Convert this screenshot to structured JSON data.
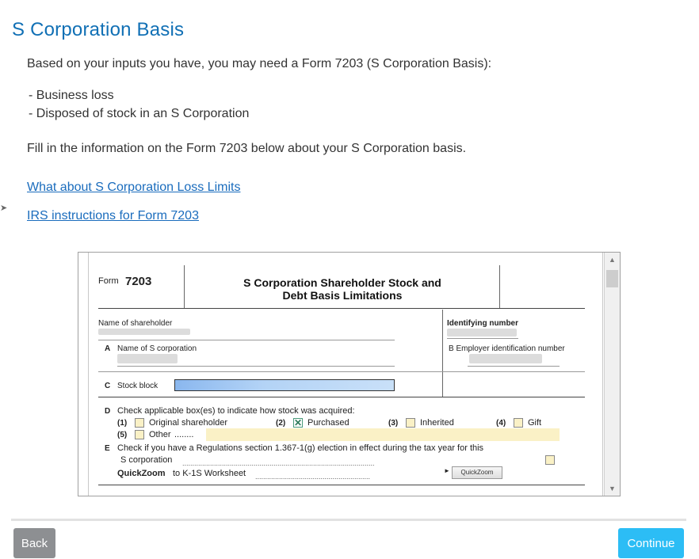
{
  "page": {
    "title": "S Corporation Basis",
    "intro": "Based on your inputs you have, you may need a Form 7203 (S Corporation Basis):",
    "reasons": [
      "- Business loss",
      "- Disposed of stock in an S Corporation"
    ],
    "fill_in": "Fill in the information on the Form 7203 below about your S Corporation basis.",
    "link_loss_limits": "What about S Corporation Loss Limits",
    "link_irs_instructions": "IRS instructions for Form 7203"
  },
  "form": {
    "form_label": "Form",
    "form_number": "7203",
    "heading_line1": "S Corporation Shareholder Stock and",
    "heading_line2": "Debt Basis Limitations",
    "name_of_shareholder": "Name of shareholder",
    "identifying_number": "Identifying number",
    "line_a_letter": "A",
    "line_a_label": "Name of S corporation",
    "line_b_label": "B Employer identification  number",
    "line_c_letter": "C",
    "line_c_label": "Stock block",
    "line_d_letter": "D",
    "line_d_label": "Check applicable box(es) to indicate how stock was acquired:",
    "opt1_num": "(1)",
    "opt1_label": "Original shareholder",
    "opt2_num": "(2)",
    "opt2_label": "Purchased",
    "opt2_mark": "✕",
    "opt3_num": "(3)",
    "opt3_label": "Inherited",
    "opt4_num": "(4)",
    "opt4_label": "Gift",
    "opt5_num": "(5)",
    "opt5_label": "Other",
    "opt5_dots": "........",
    "line_e_letter": "E",
    "line_e_label": "Check if you have a Regulations section 1.367-1(g) election in effect during the tax year for this",
    "line_e_label2": "S corporation",
    "line_e_dots": ".................................................................................................",
    "quickzoom_label": "QuickZoom",
    "quickzoom_rest": "to K-1S Worksheet",
    "quickzoom_dots": "..........................................................",
    "quickzoom_arrow": "►",
    "quickzoom_button": "QuickZoom"
  },
  "scroll": {
    "up": "▲",
    "down": "▼"
  },
  "footer": {
    "back": "Back",
    "continue": "Continue"
  }
}
